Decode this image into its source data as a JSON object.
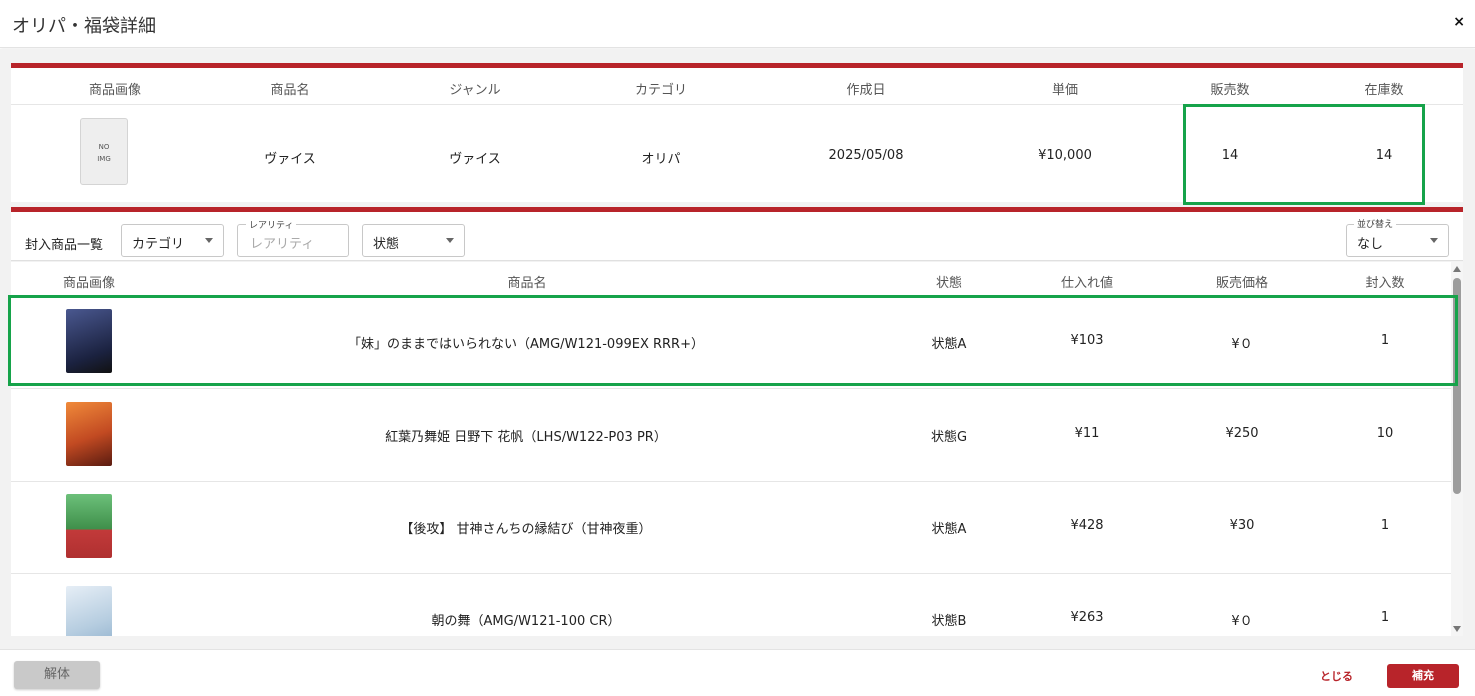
{
  "modal": {
    "title": "オリパ・福袋詳細",
    "close_label": "×"
  },
  "summary": {
    "headers": [
      "商品画像",
      "商品名",
      "ジャンル",
      "カテゴリ",
      "作成日",
      "単価",
      "販売数",
      "在庫数"
    ],
    "image_text_line1": "NO",
    "image_text_line2": "IMG",
    "values": {
      "product_name": "ヴァイス",
      "genre": "ヴァイス",
      "category": "オリパ",
      "created": "2025/05/08",
      "unit_price": "¥10,000",
      "sold": "14",
      "stock": "14"
    }
  },
  "toolbar": {
    "label": "封入商品一覧",
    "category_select": "カテゴリ",
    "rarity_label": "レアリティ",
    "rarity_placeholder": "レアリティ",
    "condition_select": "状態",
    "sort_label": "並び替え",
    "sort_value": "なし"
  },
  "list": {
    "headers": [
      "商品画像",
      "商品名",
      "状態",
      "仕入れ値",
      "販売価格",
      "封入数"
    ],
    "rows": [
      {
        "name": "「妹」のままではいられない（AMG/W121-099EX RRR+）",
        "condition": "状態A",
        "cost": "¥103",
        "price": "¥０",
        "qty": "1",
        "thumb_color": "#283050"
      },
      {
        "name": "紅葉乃舞姫 日野下 花帆（LHS/W122-P03 PR）",
        "condition": "状態G",
        "cost": "¥11",
        "price": "¥250",
        "qty": "10",
        "thumb_color": "#c24a22"
      },
      {
        "name": "【後攻】 甘神さんちの縁結び（甘神夜重）",
        "condition": "状態A",
        "cost": "¥428",
        "price": "¥30",
        "qty": "1",
        "thumb_color": "#4f9a57"
      },
      {
        "name": "朝の舞（AMG/W121-100 CR）",
        "condition": "状態B",
        "cost": "¥263",
        "price": "¥０",
        "qty": "1",
        "thumb_color": "#b6cde0"
      }
    ]
  },
  "footer": {
    "dismantle_label": "解体",
    "close_label": "とじる",
    "refill_label": "補充"
  },
  "colors": {
    "accent": "#b8242a",
    "highlight": "#16a34a"
  }
}
